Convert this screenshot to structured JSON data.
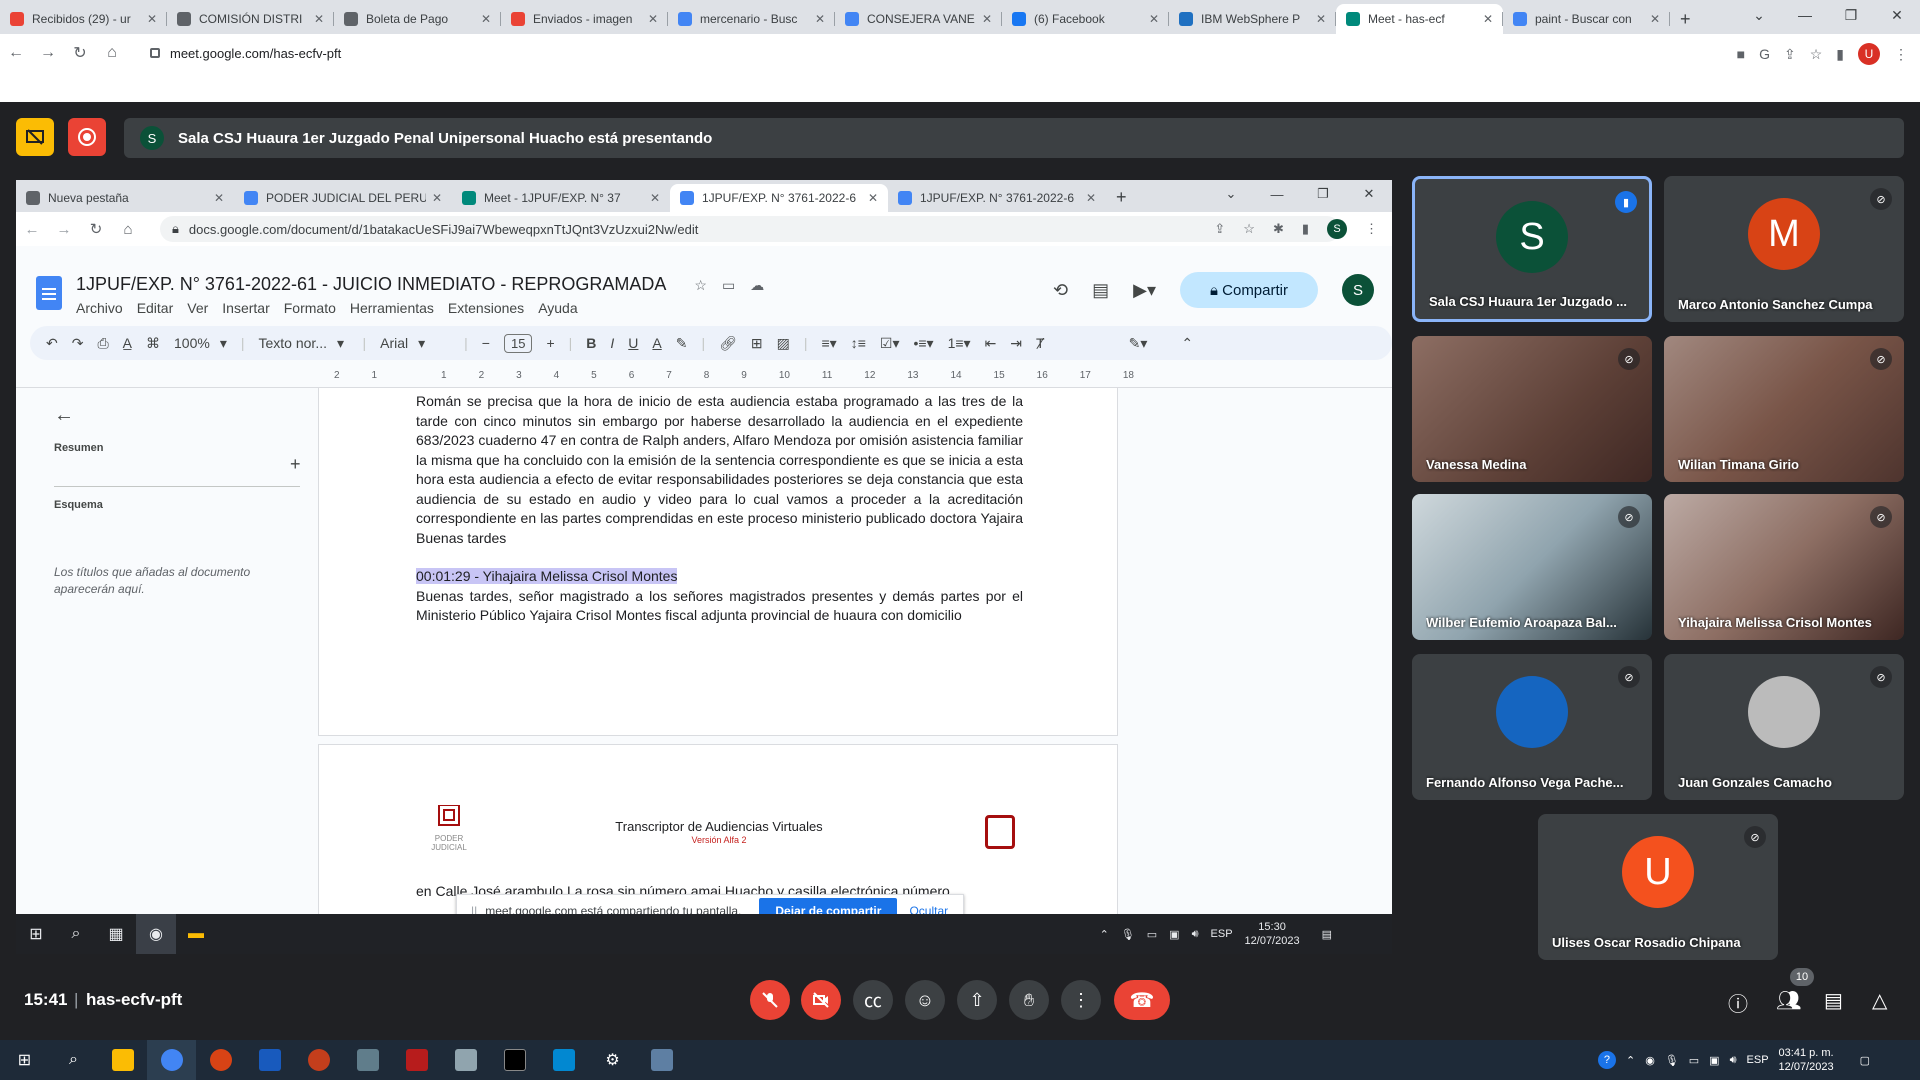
{
  "browser": {
    "tabs": [
      {
        "title": "Recibidos (29) - ur",
        "color": "#ea4335"
      },
      {
        "title": "COMISIÓN DISTRI",
        "color": "#5f6368"
      },
      {
        "title": "Boleta de Pago",
        "color": "#5f6368"
      },
      {
        "title": "Enviados - imagen",
        "color": "#ea4335"
      },
      {
        "title": "mercenario - Busc",
        "color": "#4285f4"
      },
      {
        "title": "CONSEJERA VANE",
        "color": "#4285f4"
      },
      {
        "title": "(6) Facebook",
        "color": "#1877f2"
      },
      {
        "title": "IBM WebSphere P",
        "color": "#1f70c1"
      },
      {
        "title": "Meet - has-ecf",
        "color": "#00897b"
      },
      {
        "title": "paint - Buscar con",
        "color": "#4285f4"
      }
    ],
    "active_tab_index": 8,
    "url": "meet.google.com/has-ecfv-pft",
    "profile_initial": "U"
  },
  "meet": {
    "presenter_initial": "S",
    "presenting_text": "Sala CSJ Huaura 1er Juzgado Penal Unipersonal Huacho está presentando",
    "time": "15:41",
    "meeting_code": "has-ecfv-pft",
    "participants_count": "10",
    "participants": [
      {
        "name": "Sala CSJ Huaura 1er Juzgado ...",
        "initial": "S",
        "avatar_color": "#0b5138",
        "speaking": true,
        "video": false
      },
      {
        "name": "Marco Antonio Sanchez Cumpa",
        "initial": "M",
        "avatar_color": "#d84315",
        "speaking": false,
        "video": false
      },
      {
        "name": "Vanessa Medina",
        "initial": "",
        "avatar_color": "",
        "speaking": false,
        "video": true
      },
      {
        "name": "Wilian Timana Girio",
        "initial": "",
        "avatar_color": "",
        "speaking": false,
        "video": true
      },
      {
        "name": "Wilber Eufemio Aroapaza Bal...",
        "initial": "",
        "avatar_color": "",
        "speaking": false,
        "video": true
      },
      {
        "name": "Yihajaira Melissa Crisol Montes",
        "initial": "",
        "avatar_color": "",
        "speaking": false,
        "video": true
      },
      {
        "name": "Fernando Alfonso Vega Pache...",
        "initial": "",
        "avatar_color": "#1565c0",
        "speaking": false,
        "video": false
      },
      {
        "name": "Juan Gonzales Camacho",
        "initial": "",
        "avatar_color": "#bbbbbb",
        "speaking": false,
        "video": false
      },
      {
        "name": "Ulises Oscar Rosadio Chipana",
        "initial": "U",
        "avatar_color": "#f4511e",
        "speaking": false,
        "video": false
      }
    ]
  },
  "shared_screen": {
    "tabs": [
      {
        "title": "Nueva pestaña",
        "color": "#5f6368"
      },
      {
        "title": "PODER JUDICIAL DEL PERU -",
        "color": "#4285f4"
      },
      {
        "title": "Meet - 1JPUF/EXP. N° 37",
        "color": "#00897b"
      },
      {
        "title": "1JPUF/EXP. N° 3761-2022-6",
        "color": "#4285f4"
      },
      {
        "title": "1JPUF/EXP. N° 3761-2022-6",
        "color": "#4285f4"
      }
    ],
    "active_tab_index": 3,
    "url": "docs.google.com/document/d/1batakacUeSFiJ9ai7WbeweqpxnTtJQnt3VzUzxui2Nw/edit",
    "profile_initial": "S",
    "doc": {
      "title": "1JPUF/EXP. N° 3761-2022-61 - JUICIO INMEDIATO - REPROGRAMADA",
      "menu": [
        "Archivo",
        "Editar",
        "Ver",
        "Insertar",
        "Formato",
        "Herramientas",
        "Extensiones",
        "Ayuda"
      ],
      "share_label": "Compartir",
      "zoom": "100%",
      "style": "Texto nor...",
      "font": "Arial",
      "font_size": "15",
      "ruler": [
        "2",
        "1",
        "",
        "1",
        "2",
        "3",
        "4",
        "5",
        "6",
        "7",
        "8",
        "9",
        "10",
        "11",
        "12",
        "13",
        "14",
        "15",
        "16",
        "17",
        "18"
      ],
      "outline": {
        "summary_label": "Resumen",
        "outline_label": "Esquema",
        "hint": "Los títulos que añadas al documento aparecerán aquí."
      },
      "paragraph1": "Román se precisa que la hora de inicio de esta audiencia estaba programado a las tres de la tarde con cinco minutos sin embargo por haberse desarrollado la audiencia en el expediente 683/2023 cuaderno 47 en contra de Ralph anders, Alfaro Mendoza por omisión asistencia familiar la misma que ha concluido con la emisión de la sentencia correspondiente es que se inicia a esta hora esta audiencia a efecto de evitar responsabilidades posteriores se deja constancia que esta audiencia de su estado en audio y video para lo cual vamos a proceder a la acreditación correspondiente en las partes comprendidas en este proceso ministerio publicado doctora Yajaira Buenas tardes",
      "speaker_line": "00:01:29 - Yihajaira Melissa Crisol Montes",
      "paragraph2": "Buenas tardes, señor magistrado a los señores magistrados presentes y demás partes por el Ministerio Público Yajaira Crisol Montes fiscal adjunta provincial de huaura con domicilio",
      "page2_header": "Transcriptor de Audiencias Virtuales",
      "page2_sub": "Versión Alfa 2",
      "page2_logo_text": "PODER JUDICIAL",
      "page2_text": "en Calle José arambulo La rosa sin número amaj Huacho y casilla electrónica número"
    },
    "share_notice": {
      "text": "meet.google.com está compartiendo tu pantalla.",
      "stop_label": "Dejar de compartir",
      "hide_label": "Ocultar"
    },
    "taskbar": {
      "lang": "ESP",
      "time": "15:30",
      "date": "12/07/2023"
    }
  },
  "os_taskbar": {
    "lang": "ESP",
    "time": "03:41 p. m.",
    "date": "12/07/2023"
  }
}
